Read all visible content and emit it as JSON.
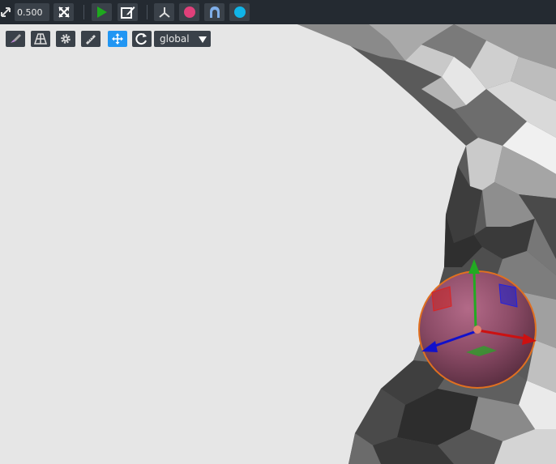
{
  "toolbar": {
    "scale_icon": "resize-arrows-icon",
    "zoom_value": "0.500",
    "fit_icon": "expand-icon",
    "play_icon": "play-icon",
    "edit_icon": "edit-icon",
    "axes_icon": "axes-icon",
    "sphere_icon": "pink-circle-icon",
    "mesh_icon": "arch-mesh-icon",
    "marker_icon": "cyan-circle-icon"
  },
  "viewport_toolbar": {
    "paint_icon": "brush-icon",
    "camera_icon": "perspective-grid-icon",
    "settings_icon": "gear-icon",
    "ruler_icon": "ruler-icon",
    "move_icon": "move-arrows-icon",
    "rotate_icon": "rotate-icon",
    "space_value": "global",
    "dropdown_icon": "dropdown-triangle-icon"
  },
  "colors": {
    "toolbar_bg": "#242a31",
    "button_bg": "#3a4149",
    "active_blue": "#2196f3",
    "viewport_bg": "#e6e6e6",
    "gizmo_x": "#cc1111",
    "gizmo_y": "#22aa22",
    "gizmo_z": "#1111cc",
    "sphere": "#9a4d6a",
    "sphere_outline": "#e07020"
  }
}
